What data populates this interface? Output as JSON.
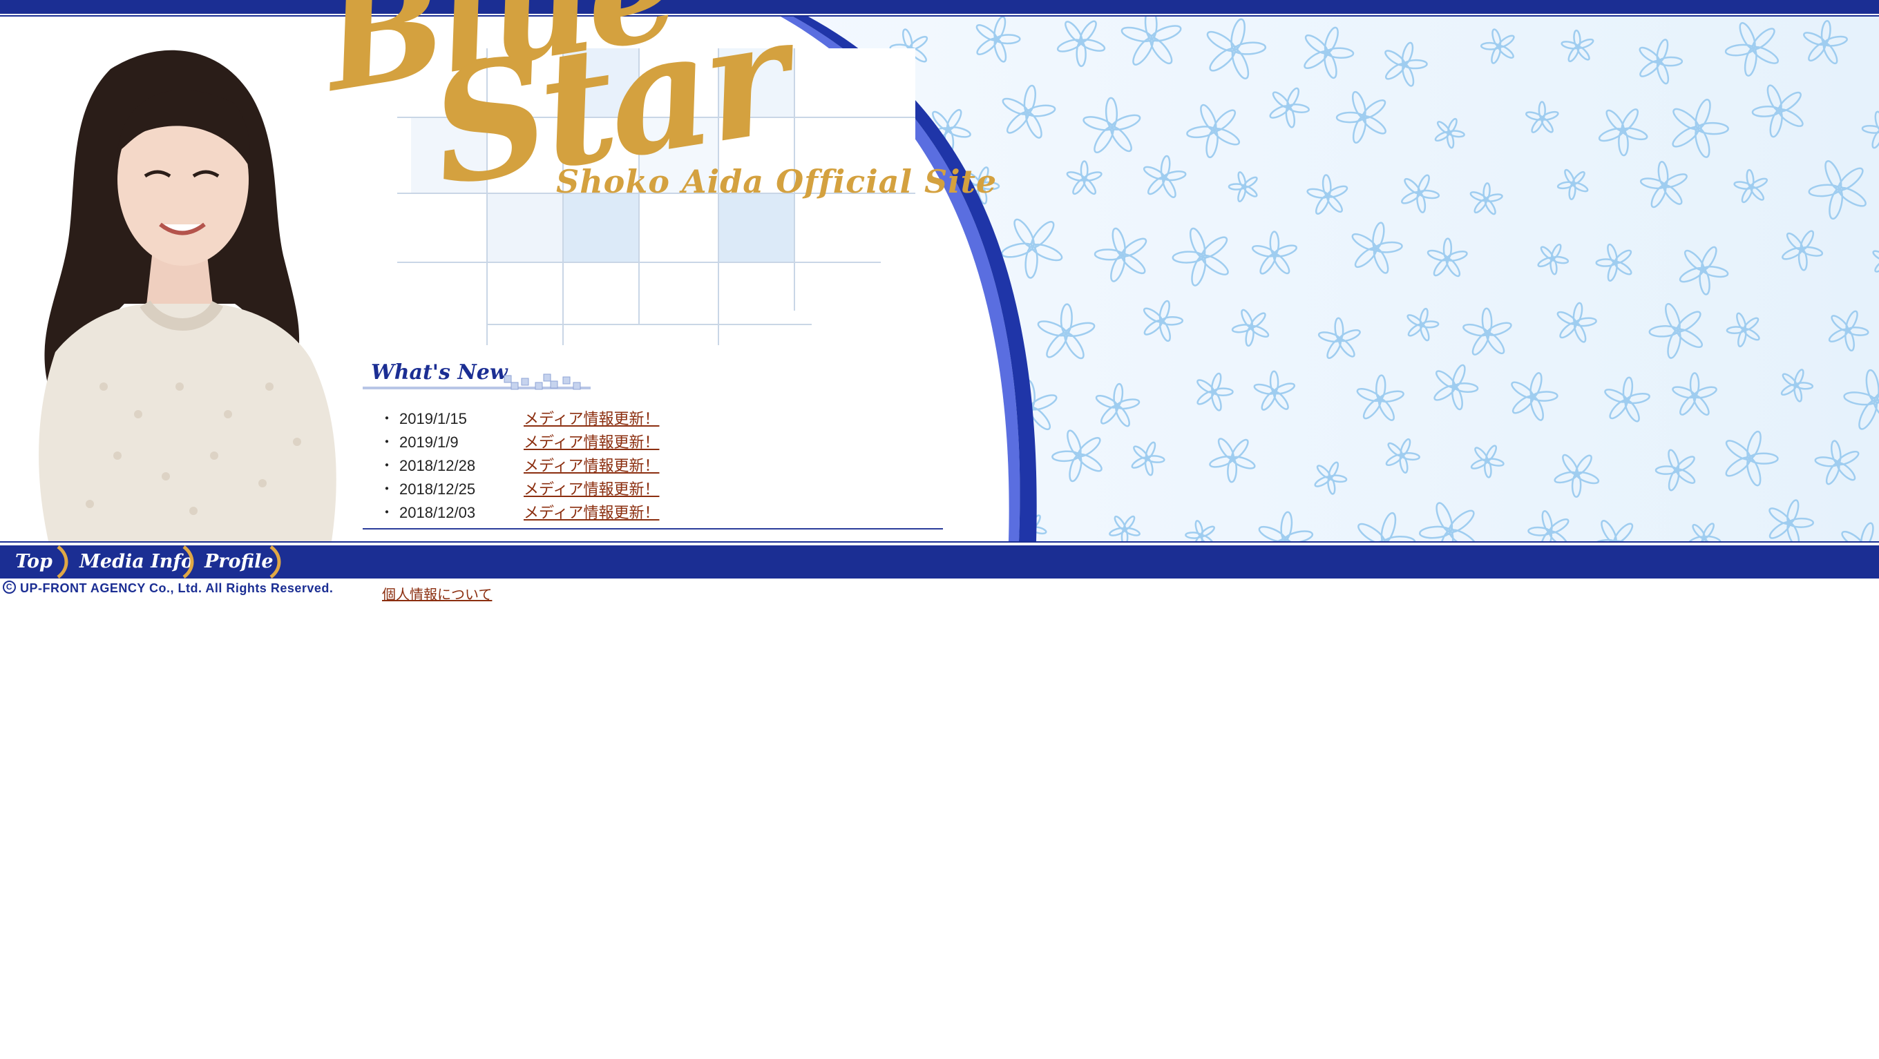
{
  "header": {
    "logo_line1": "Blue",
    "logo_line2": "Star",
    "logo_subtitle": "Shoko Aida Official Site"
  },
  "whats_new": {
    "title": "What's New",
    "items": [
      {
        "date": "2019/1/15",
        "label": "メディア情報更新！"
      },
      {
        "date": "2019/1/9",
        "label": "メディア情報更新！"
      },
      {
        "date": "2018/12/28",
        "label": "メディア情報更新！"
      },
      {
        "date": "2018/12/25",
        "label": "メディア情報更新！"
      },
      {
        "date": "2018/12/03",
        "label": "メディア情報更新！"
      }
    ],
    "bullet": "・"
  },
  "nav": {
    "items": [
      {
        "label": "Top"
      },
      {
        "label": "Media Info"
      },
      {
        "label": "Profile"
      }
    ]
  },
  "footer": {
    "copyright_symbol": "C",
    "copyright": "UP-FRONT AGENCY Co., Ltd. All Rights Reserved.",
    "privacy_link": "個人情報について"
  },
  "colors": {
    "brand_navy": "#1b2e93",
    "logo_gold": "#d4a13f",
    "link_brown": "#8b2e0f",
    "flower_blue": "#9fcdf0"
  },
  "icons": [
    "flower-pattern",
    "portrait-photo",
    "title-blocks-icon",
    "nav-separator-arc-icon"
  ]
}
